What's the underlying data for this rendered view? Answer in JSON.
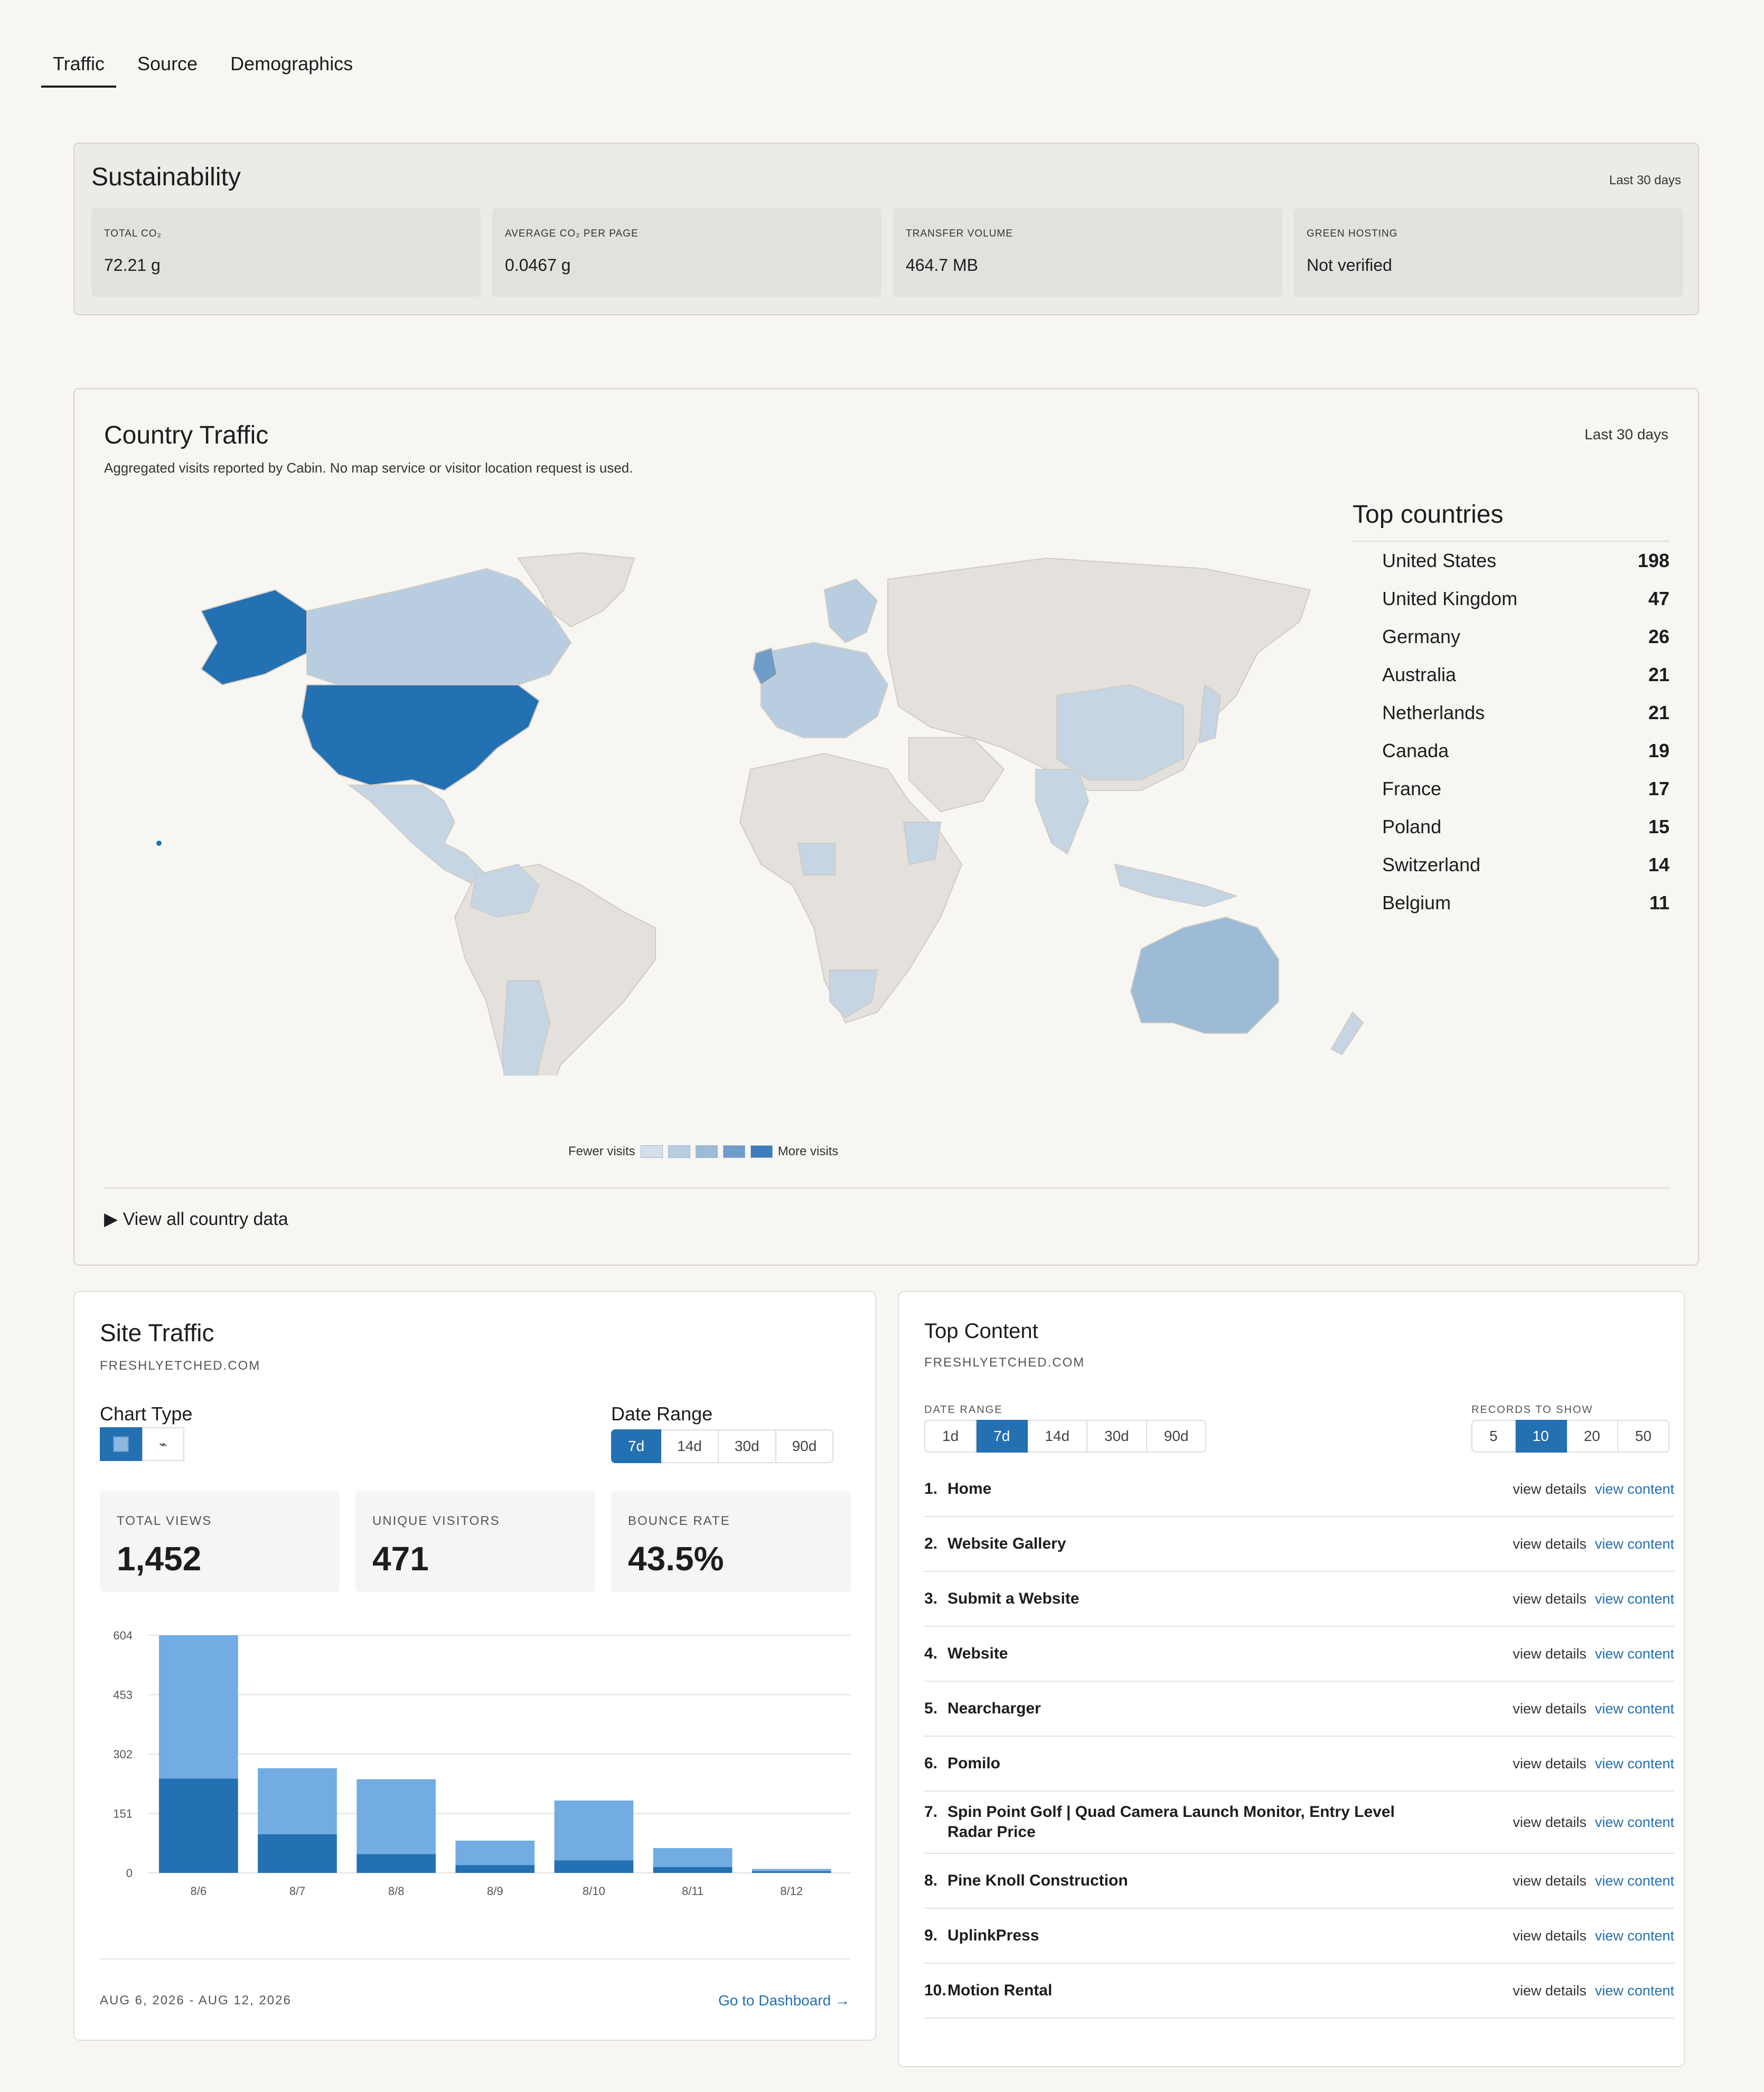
{
  "tabs": [
    "Traffic",
    "Source",
    "Demographics"
  ],
  "sustainability": {
    "title": "Sustainability",
    "range": "Last 30 days",
    "cards": [
      {
        "label": "TOTAL CO₂",
        "value": "72.21 g"
      },
      {
        "label": "AVERAGE CO₂ PER PAGE",
        "value": "0.0467 g"
      },
      {
        "label": "TRANSFER VOLUME",
        "value": "464.7 MB"
      },
      {
        "label": "GREEN HOSTING",
        "value": "Not verified"
      }
    ]
  },
  "country_traffic": {
    "title": "Country Traffic",
    "range": "Last 30 days",
    "subtitle": "Aggregated visits reported by Cabin. No map service or visitor location request is used.",
    "legend_low": "Fewer visits",
    "legend_high": "More visits",
    "legend_colors": [
      "#d3dfea",
      "#b9cde0",
      "#9dbad6",
      "#6f9cc9",
      "#3d7dbd"
    ],
    "details_label": "▶ View all country data",
    "top_title": "Top countries",
    "top": [
      {
        "country": "United States",
        "visits": "198"
      },
      {
        "country": "United Kingdom",
        "visits": "47"
      },
      {
        "country": "Germany",
        "visits": "26"
      },
      {
        "country": "Australia",
        "visits": "21"
      },
      {
        "country": "Netherlands",
        "visits": "21"
      },
      {
        "country": "Canada",
        "visits": "19"
      },
      {
        "country": "France",
        "visits": "17"
      },
      {
        "country": "Poland",
        "visits": "15"
      },
      {
        "country": "Switzerland",
        "visits": "14"
      },
      {
        "country": "Belgium",
        "visits": "11"
      }
    ]
  },
  "site_traffic": {
    "title": "Site Traffic",
    "domain": "FRESHLYETCHED.COM",
    "chart_type_label": "Chart Type",
    "line_icon": "⌁",
    "date_range_label": "Date Range",
    "date_ranges": [
      "7d",
      "14d",
      "30d",
      "90d"
    ],
    "kpis": [
      {
        "label": "TOTAL VIEWS",
        "value": "1,452"
      },
      {
        "label": "UNIQUE VISITORS",
        "value": "471"
      },
      {
        "label": "BOUNCE RATE",
        "value": "43.5%"
      }
    ],
    "date_span": "AUG 6, 2026 - AUG 12, 2026",
    "link": "Go to Dashboard →"
  },
  "chart_data": {
    "type": "bar",
    "stacked": true,
    "categories": [
      "8/6",
      "8/7",
      "8/8",
      "8/9",
      "8/10",
      "8/11",
      "8/12"
    ],
    "series": [
      {
        "values": [
          240,
          98,
          48,
          20,
          32,
          15,
          4
        ],
        "color": "#2370b3"
      },
      {
        "values": [
          364,
          168,
          190,
          62,
          152,
          48,
          6
        ],
        "color": "#72ace3"
      }
    ],
    "yticks": [
      0,
      151,
      302,
      453,
      604
    ],
    "ylim": [
      0,
      604
    ],
    "grid": true
  },
  "top_content": {
    "title": "Top Content",
    "domain": "FRESHLYETCHED.COM",
    "date_range_label": "DATE RANGE",
    "date_ranges": [
      "1d",
      "7d",
      "14d",
      "30d",
      "90d"
    ],
    "records_label": "RECORDS TO SHOW",
    "records": [
      "5",
      "10",
      "20",
      "50"
    ],
    "details_label": "view details",
    "content_label": "view content",
    "items": [
      {
        "num": "1.",
        "name": "Home"
      },
      {
        "num": "2.",
        "name": "Website Gallery"
      },
      {
        "num": "3.",
        "name": "Submit a Website"
      },
      {
        "num": "4.",
        "name": "Website"
      },
      {
        "num": "5.",
        "name": "Nearcharger"
      },
      {
        "num": "6.",
        "name": "Pomilo"
      },
      {
        "num": "7.",
        "name": "Spin Point Golf | Quad Camera Launch Monitor, Entry Level Radar Price"
      },
      {
        "num": "8.",
        "name": "Pine Knoll Construction"
      },
      {
        "num": "9.",
        "name": "UplinkPress"
      },
      {
        "num": "10.",
        "name": "Motion Rental"
      }
    ]
  }
}
